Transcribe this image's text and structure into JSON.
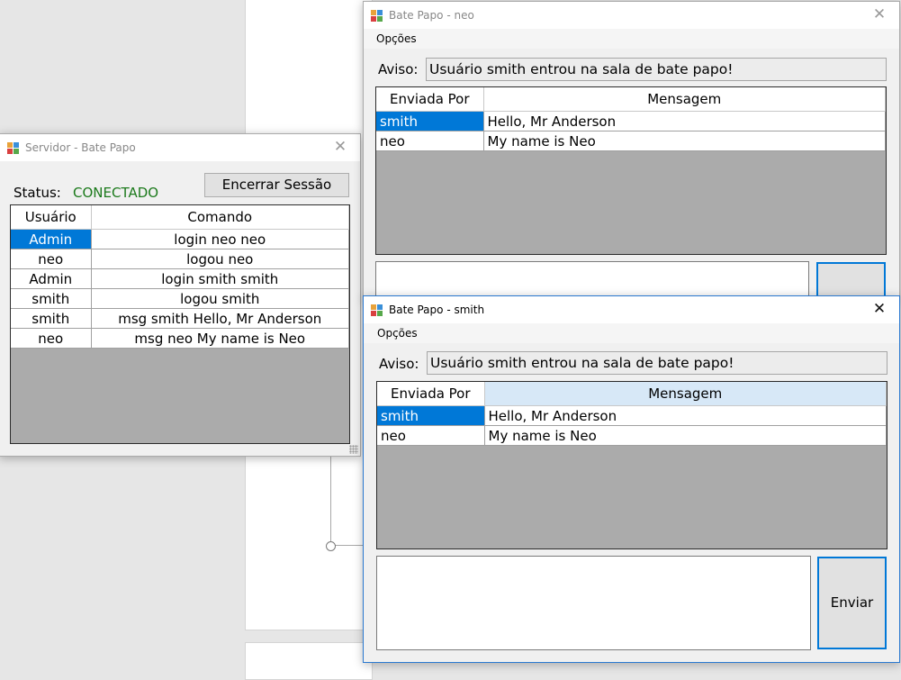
{
  "server": {
    "title": "Servidor - Bate Papo",
    "status_label": "Status:",
    "status_value": "CONECTADO",
    "status_color": "#1c7a1c",
    "end_session_button": "Encerrar Sessão",
    "grid": {
      "columns": [
        "Usuário",
        "Comando"
      ],
      "rows": [
        {
          "user": "Admin",
          "command": "login neo neo"
        },
        {
          "user": "neo",
          "command": "logou neo"
        },
        {
          "user": "Admin",
          "command": "login smith smith"
        },
        {
          "user": "smith",
          "command": "logou smith"
        },
        {
          "user": "smith",
          "command": "msg smith Hello, Mr Anderson"
        },
        {
          "user": "neo",
          "command": "msg neo My name is Neo"
        }
      ]
    }
  },
  "chat_neo": {
    "title": "Bate Papo - neo",
    "menu": "Opções",
    "notice_label": "Aviso:",
    "notice_text": "Usuário smith entrou na sala de bate papo!",
    "grid": {
      "columns": [
        "Enviada Por",
        "Mensagem"
      ],
      "rows": [
        {
          "sender": "smith",
          "message": "Hello, Mr Anderson"
        },
        {
          "sender": "neo",
          "message": "My name is Neo"
        }
      ]
    }
  },
  "chat_smith": {
    "title": "Bate Papo - smith",
    "menu": "Opções",
    "notice_label": "Aviso:",
    "notice_text": "Usuário smith entrou na sala de bate papo!",
    "grid": {
      "columns": [
        "Enviada Por",
        "Mensagem"
      ],
      "rows": [
        {
          "sender": "smith",
          "message": "Hello, Mr Anderson"
        },
        {
          "sender": "neo",
          "message": "My name is Neo"
        }
      ]
    },
    "send_button": "Enviar"
  },
  "colors": {
    "selection": "#0078d7",
    "grid_background": "#ababab",
    "active_border": "#2b79d0"
  },
  "icons": {
    "app_icon": "windows-forms-app-icon",
    "close": "close-icon"
  }
}
